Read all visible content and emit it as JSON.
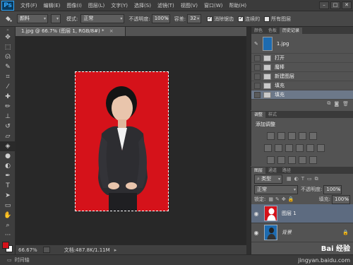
{
  "app": {
    "logo": "Ps"
  },
  "menu": [
    "文件(F)",
    "编辑(E)",
    "图像(I)",
    "图层(L)",
    "文字(Y)",
    "选择(S)",
    "滤镜(T)",
    "视图(V)",
    "窗口(W)",
    "帮助(H)"
  ],
  "window_controls": [
    "–",
    "□",
    "✕"
  ],
  "options": {
    "brush_preset": "颜料",
    "mode_label": "模式:",
    "mode_value": "正常",
    "opacity_label": "不透明度:",
    "opacity_value": "100%",
    "tolerance_label": "容差:",
    "tolerance_value": "32",
    "antialias_label": "消除锯齿",
    "contiguous_label": "连续的",
    "all_layers_label": "所有图层",
    "antialias_checked": true,
    "contiguous_checked": true,
    "all_layers_checked": false
  },
  "document": {
    "tab_title": "1.jpg @ 66.7% (图层 1, RGB/8#) *",
    "tab_close": "×",
    "zoom": "66.67%",
    "doc_size": "文档:487.8K/1.11M"
  },
  "bottom": {
    "timeline_label": "时间轴",
    "watermark": "jingyan.baidu.com",
    "watermark_brand": "Bai 经验"
  },
  "panels": {
    "top_tabs": [
      "颜色",
      "色板",
      "历史记录"
    ],
    "history": {
      "snapshot_name": "1.jpg",
      "items": [
        "打开",
        "魔棒",
        "新建图层",
        "填充",
        "填充"
      ]
    },
    "adjust_tabs": [
      "调整",
      "样式"
    ],
    "adjust_title": "添加调整",
    "layer_tabs": [
      "图层",
      "通道",
      "路径"
    ],
    "layer_filter": "类型",
    "blend_mode": "正常",
    "opacity_label": "不透明度:",
    "opacity_value": "100%",
    "lock_label": "锁定:",
    "fill_label": "填充:",
    "fill_value": "100%",
    "layers": [
      {
        "name": "图层 1",
        "selected": true
      },
      {
        "name": "背景",
        "selected": false
      }
    ]
  },
  "colors": {
    "canvas_red": "#d5121a",
    "selection_blue": "#6c7889",
    "app_bg": "#535353"
  }
}
